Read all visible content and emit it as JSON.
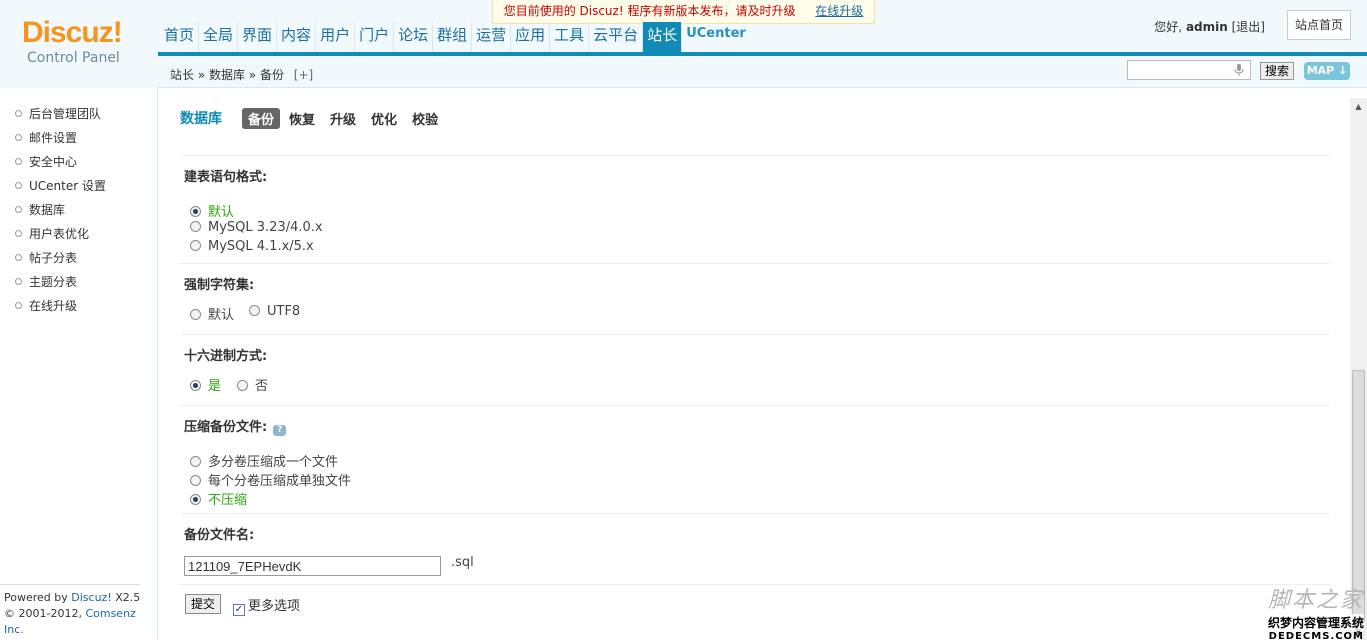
{
  "logo": {
    "brand": "Discuz!",
    "subtitle": "Control Panel"
  },
  "notice": {
    "text": "您目前使用的 Discuz! 程序有新版本发布，请及时升级",
    "link": "在线升级"
  },
  "user": {
    "greeting": "您好,",
    "name": "admin",
    "logout": "[退出]",
    "home_button": "站点首页"
  },
  "nav": {
    "items": [
      "首页",
      "全局",
      "界面",
      "内容",
      "用户",
      "门户",
      "论坛",
      "群组",
      "运营",
      "应用",
      "工具",
      "云平台",
      "站长"
    ],
    "active": "站长",
    "ucenter": "UCenter"
  },
  "breadcrumb": {
    "text": "站长 » 数据库 » 备份",
    "plus": "[+]"
  },
  "search": {
    "value": "",
    "button": "搜索",
    "map": "MAP"
  },
  "sidebar": {
    "items": [
      "后台管理团队",
      "邮件设置",
      "安全中心",
      "UCenter 设置",
      "数据库",
      "用户表优化",
      "帖子分表",
      "主题分表",
      "在线升级"
    ]
  },
  "footer": {
    "line1_prefix": "Powered by",
    "line1_brand": "Discuz!",
    "line1_version": "X2.5",
    "line2_prefix": "© 2001-2012,",
    "line2_company": "Comsenz Inc."
  },
  "main": {
    "title": "数据库",
    "tabs": [
      "备份",
      "恢复",
      "升级",
      "优化",
      "校验"
    ],
    "active_tab": "备份",
    "sections": {
      "sql_format": {
        "title": "建表语句格式:",
        "options": [
          "默认",
          "MySQL 3.23/4.0.x",
          "MySQL 4.1.x/5.x"
        ],
        "selected": 0
      },
      "charset": {
        "title": "强制字符集:",
        "options": [
          "默认",
          "UTF8"
        ],
        "selected": -1
      },
      "hex": {
        "title": "十六进制方式:",
        "options": [
          "是",
          "否"
        ],
        "selected": 0
      },
      "compress": {
        "title": "压缩备份文件:",
        "options": [
          "多分卷压缩成一个文件",
          "每个分卷压缩成单独文件",
          "不压缩"
        ],
        "selected": 2
      },
      "filename": {
        "title": "备份文件名:",
        "value": "121109_7EPHevdK",
        "ext": ".sql"
      }
    },
    "submit_label": "提交",
    "more_options_label": "更多选项",
    "more_options_checked": true
  },
  "watermark": {
    "line1": "脚本之家",
    "line2": "织梦内容管理系统",
    "line3": "DEDECMS.COM"
  },
  "colors": {
    "accent": "#118ab6",
    "logo": "#f7941d",
    "selected_text": "#2aa60f",
    "notice_text": "#cc0000"
  }
}
